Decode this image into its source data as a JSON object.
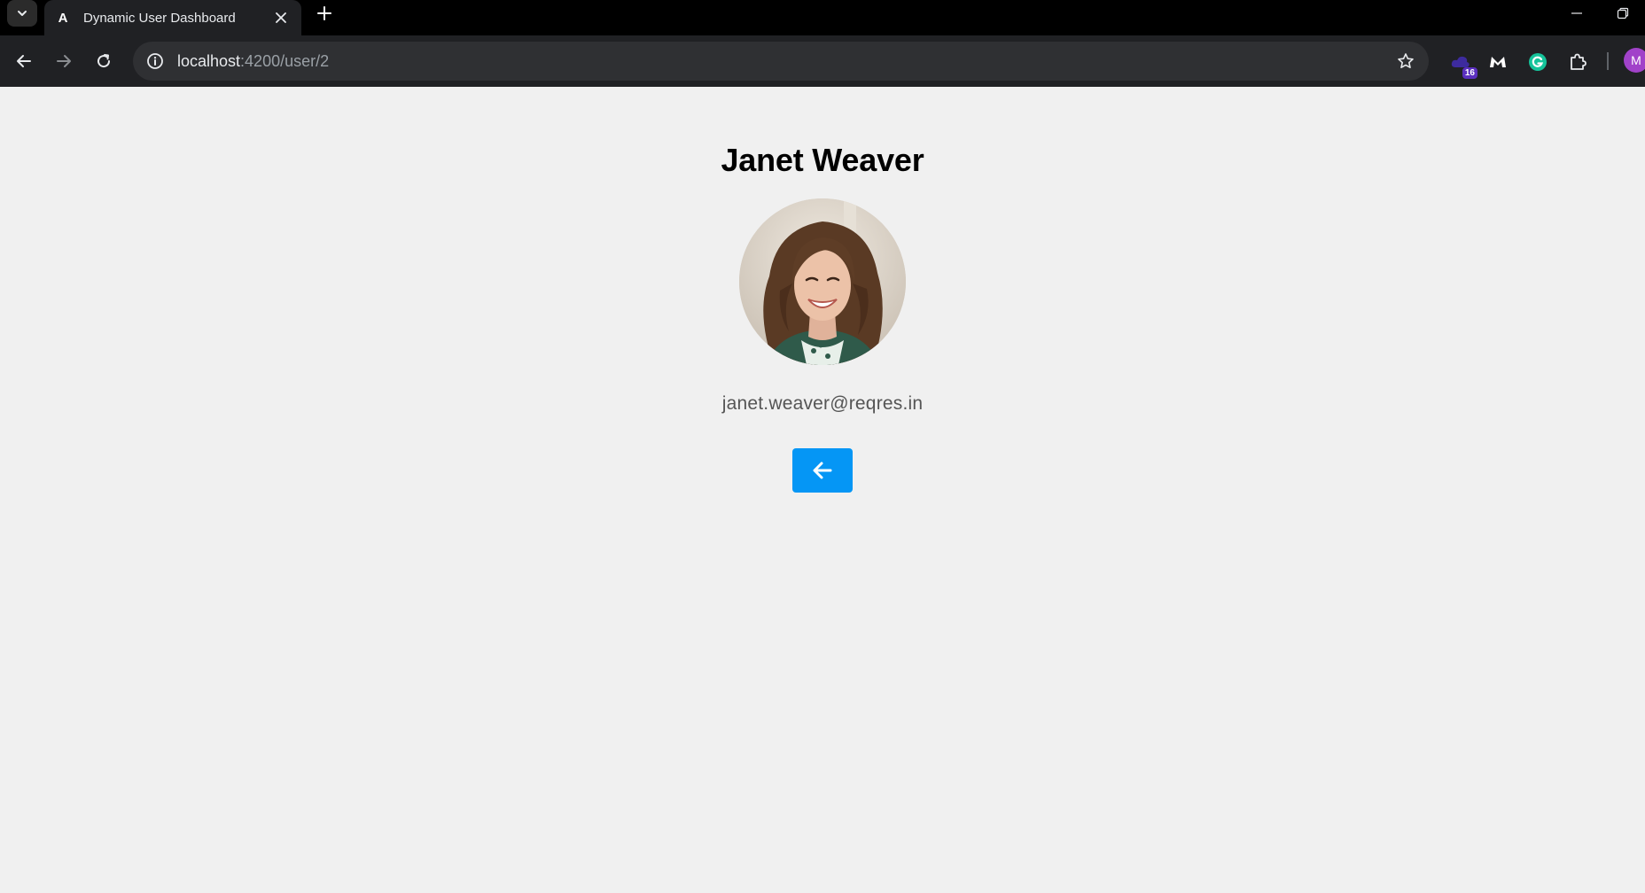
{
  "browser": {
    "tab_title": "Dynamic User Dashboard",
    "tab_favicon": "A",
    "url_host": "localhost",
    "url_path": ":4200/user/2",
    "extension_badge": "16",
    "profile_initial": "M"
  },
  "user": {
    "name": "Janet Weaver",
    "email": "janet.weaver@reqres.in"
  },
  "colors": {
    "page_background": "#f0f0f0",
    "back_button": "#0596f5",
    "email_text": "#555555"
  },
  "icons": {
    "back_button": "arrow-left-icon"
  }
}
